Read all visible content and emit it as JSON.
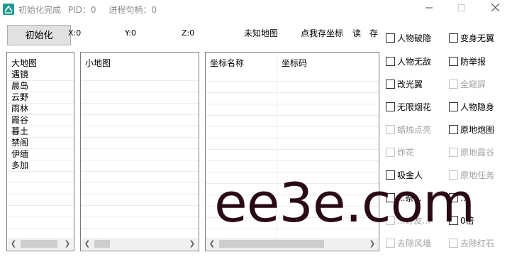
{
  "title": {
    "status": "初始化完成",
    "pid_label": "PID：0",
    "handle_label": "进程句柄：0"
  },
  "toolbar": {
    "init_button": "初始化",
    "x": "X:0",
    "y": "Y:0",
    "z": "Z:0",
    "unknown_map": "未知地图",
    "save_coord": "点我存坐标",
    "read": "读",
    "save": "存"
  },
  "big_map": {
    "header": "大地图",
    "items": [
      "遇镜",
      "晨岛",
      "云野",
      "雨林",
      "霞谷",
      "暮土",
      "禁阁",
      "伊缅",
      "多加"
    ]
  },
  "small_map": {
    "header": "小地图"
  },
  "coords_table": {
    "columns": [
      "坐标名称",
      "坐标码"
    ]
  },
  "options": [
    {
      "label": "人物破隐",
      "enabled": true
    },
    {
      "label": "变身无翼",
      "enabled": true
    },
    {
      "label": "人物无敌",
      "enabled": true
    },
    {
      "label": "防举报",
      "enabled": true
    },
    {
      "label": "改光翼",
      "enabled": true
    },
    {
      "label": "全窥屏",
      "enabled": false
    },
    {
      "label": "无限烟花",
      "enabled": true
    },
    {
      "label": "人物隐身",
      "enabled": true
    },
    {
      "label": "蜡烛点亮",
      "enabled": false
    },
    {
      "label": "原地炮图",
      "enabled": true
    },
    {
      "label": "炸花",
      "enabled": false
    },
    {
      "label": "原地霞谷",
      "enabled": false
    },
    {
      "label": "吸金人",
      "enabled": true
    },
    {
      "label": "原地任务",
      "enabled": false
    },
    {
      "label": "...祭...",
      "enabled": true
    },
    {
      "label": "...",
      "enabled": true
    },
    {
      "label": "...好友...",
      "enabled": false
    },
    {
      "label": "0倍",
      "enabled": true
    },
    {
      "label": "去除风墙",
      "enabled": false
    },
    {
      "label": "去除红石",
      "enabled": false
    }
  ],
  "watermark": "ee3e.com"
}
